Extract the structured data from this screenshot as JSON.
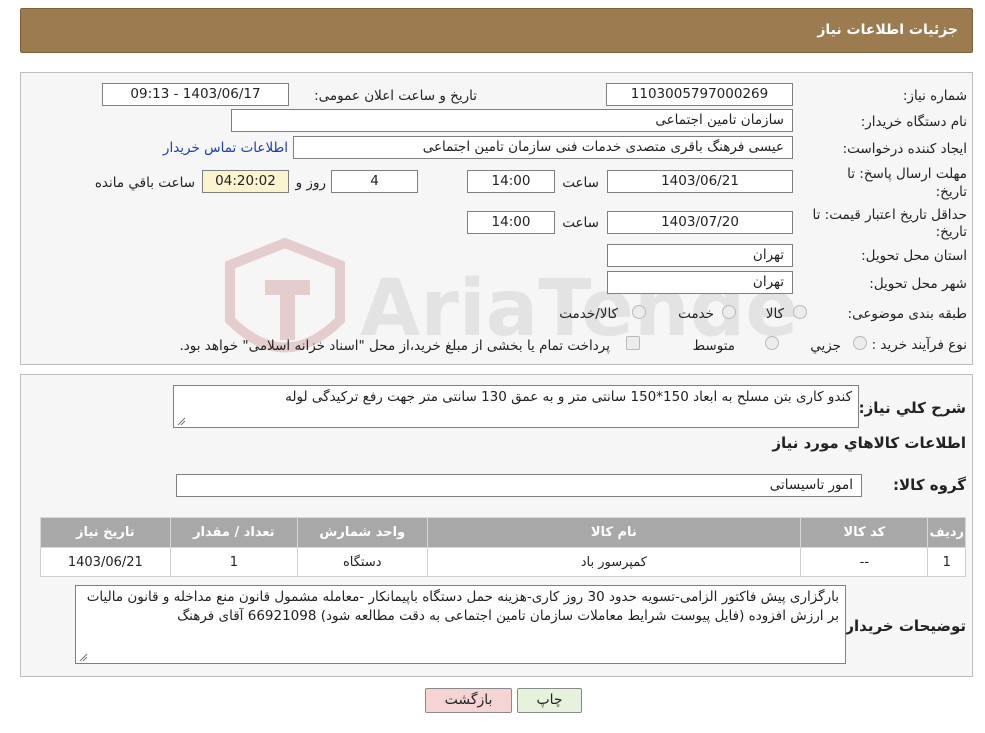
{
  "header": {
    "title": "جزئیات اطلاعات نیاز"
  },
  "watermark": {
    "text": "AriaTender.neT"
  },
  "details": {
    "need_number_label": "شماره نیاز:",
    "need_number": "1103005797000269",
    "announce_label": "تاریخ و ساعت اعلان عمومی:",
    "announce_value": "1403/06/17 - 09:13",
    "buyer_org_label": "نام دستگاه خریدار:",
    "buyer_org": "سازمان تامین اجتماعی",
    "creator_label": "ایجاد کننده درخواست:",
    "creator": "عیسی فرهنگ باقری متصدی خدمات فنی سازمان تامین اجتماعی",
    "contact_link": "اطلاعات تماس خریدار",
    "deadline_label_1": "مهلت ارسال پاسخ: تا",
    "deadline_label_2": "تاریخ:",
    "deadline_date": "1403/06/21",
    "time_label": "ساعت",
    "deadline_time": "14:00",
    "days_value": "4",
    "days_label": "روز و",
    "remaining_time": "04:20:02",
    "remaining_label": "ساعت باقي مانده",
    "validity_label_1": "حداقل تاریخ اعتبار قیمت: تا",
    "validity_label_2": "تاریخ:",
    "validity_date": "1403/07/20",
    "validity_time_label": "ساعت",
    "validity_time": "14:00",
    "province_label": "استان محل تحویل:",
    "province": "تهران",
    "city_label": "شهر محل تحویل:",
    "city": "تهران",
    "category_label": "طبقه بندی موضوعی:",
    "category_options": [
      "کالا",
      "خدمت",
      "کالا/خدمت"
    ],
    "process_label": "نوع فرآیند خرید :",
    "process_options": [
      "جزیي",
      "متوسط"
    ],
    "process_note": "پرداخت تمام یا بخشی از مبلغ خرید،از محل \"اسناد خزانه اسلامی\" خواهد بود."
  },
  "description": {
    "label": "شرح کلي نياز:",
    "text": "کندو کاری بتن مسلح به ابعاد 150*150 سانتی متر و به عمق 130 سانتی متر جهت رفع ترکیدگی لوله"
  },
  "goods": {
    "section_title": "اطلاعات کالاهاي مورد نياز",
    "group_label": "گروه کالا:",
    "group_value": "امور تاسیساتی",
    "columns": [
      "رديف",
      "کد کالا",
      "نام کالا",
      "واحد شمارش",
      "تعداد / مقدار",
      "تاریخ نیاز"
    ],
    "rows": [
      [
        "1",
        "--",
        "کمپرسور باد",
        "دستگاه",
        "1",
        "1403/06/21"
      ]
    ]
  },
  "buyer_notes": {
    "label": "توضیحات خریدار:",
    "text": "بارگزاری پیش فاکتور الزامی-تسویه حدود 30 روز کاری-هزینه حمل دستگاه  باپیمانکار  -معامله مشمول قانون منع مداخله و قانون مالیات بر ارزش افزوده (فایل پیوست شرایط معاملات سازمان تامین اجتماعی به دقت مطالعه شود) 66921098 آقای فرهنگ"
  },
  "buttons": {
    "print": "چاپ",
    "back": "بازگشت"
  },
  "colors": {
    "header": "#9b7b4f",
    "back_button": "#f6d4d4",
    "print_button": "#e6f2dc"
  }
}
